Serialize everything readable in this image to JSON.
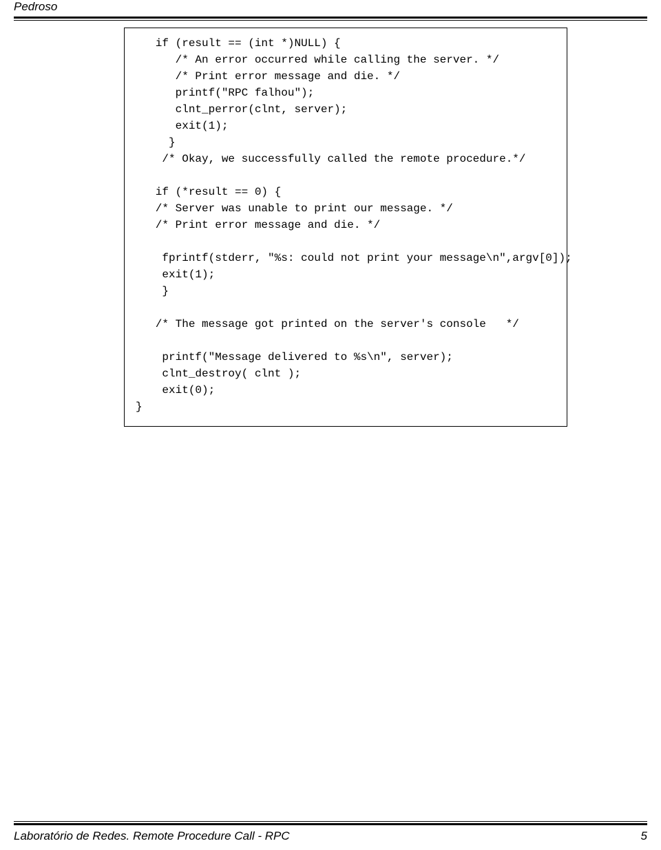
{
  "header": {
    "author": "Pedroso"
  },
  "code": {
    "lines": "   if (result == (int *)NULL) {\n      /* An error occurred while calling the server. */\n      /* Print error message and die. */\n      printf(\"RPC falhou\");\n      clnt_perror(clnt, server);\n      exit(1);\n     }\n    /* Okay, we successfully called the remote procedure.*/\n\n   if (*result == 0) {\n   /* Server was unable to print our message. */\n   /* Print error message and die. */\n\n    fprintf(stderr, \"%s: could not print your message\\n\",argv[0]);\n    exit(1);\n    }\n\n   /* The message got printed on the server's console   */\n\n    printf(\"Message delivered to %s\\n\", server);\n    clnt_destroy( clnt );\n    exit(0);\n}"
  },
  "footer": {
    "text": "Laboratório de Redes. Remote Procedure Call - RPC",
    "page": "5"
  }
}
